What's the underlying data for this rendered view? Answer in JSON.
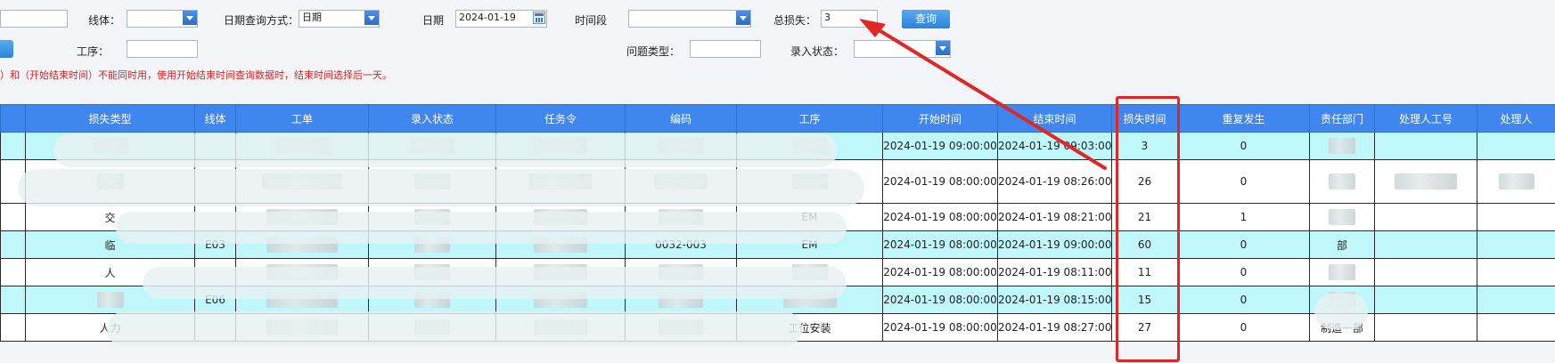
{
  "filters": {
    "line_label": "线体：",
    "date_query_mode_label": "日期查询方式：",
    "date_query_mode_value": "日期",
    "date_label": "日期",
    "date_value": "2024-01-19",
    "time_period_label": "时间段",
    "total_loss_label": "总损失：",
    "total_loss_value": "3",
    "query_button": "查询",
    "process_label": "工序：",
    "issue_type_label": "问题类型：",
    "entry_status_label": "录入状态：",
    "warning_text": "）和（开始结束时间）不能同时用，使用开始结束时间查询数据时，结束时间选择后一天。"
  },
  "table": {
    "headers": [
      "损失类型",
      "线体",
      "工单",
      "录入状态",
      "任务令",
      "编码",
      "工序",
      "开始时间",
      "结束时间",
      "损失时间",
      "重复发生",
      "责任部门",
      "处理人工号",
      "处理人"
    ],
    "rows": [
      {
        "loss_type": "",
        "line": "",
        "order": "",
        "status": "",
        "task": "",
        "code": "",
        "process": "",
        "start": "2024-01-19 09:00:00",
        "end": "2024-01-19 09:03:00",
        "loss_time": "3",
        "repeat": "0",
        "dept": ""
      },
      {
        "loss_type": "",
        "line": "",
        "order": "",
        "status": "",
        "task": "",
        "code": "",
        "process": "",
        "start": "2024-01-19 08:00:00",
        "end": "2024-01-19 08:26:00",
        "loss_time": "26",
        "repeat": "0",
        "dept": ""
      },
      {
        "loss_type": "交",
        "line": "",
        "order": "",
        "status": "",
        "task": "",
        "code": "",
        "process": "EM",
        "start": "2024-01-19 08:00:00",
        "end": "2024-01-19 08:21:00",
        "loss_time": "21",
        "repeat": "1",
        "dept": ""
      },
      {
        "loss_type": "临",
        "line": "E03",
        "order": "",
        "status": "",
        "task": "",
        "code": "0032-003",
        "process": "EM",
        "start": "2024-01-19 08:00:00",
        "end": "2024-01-19 09:00:00",
        "loss_time": "60",
        "repeat": "0",
        "dept": "部"
      },
      {
        "loss_type": "人",
        "line": "",
        "order": "",
        "status": "",
        "task": "",
        "code": "",
        "process": "",
        "start": "2024-01-19 08:00:00",
        "end": "2024-01-19 08:11:00",
        "loss_time": "11",
        "repeat": "0",
        "dept": ""
      },
      {
        "loss_type": "",
        "line": "E06",
        "order": "",
        "status": "",
        "task": "",
        "code": "",
        "process": "",
        "start": "2024-01-19 08:00:00",
        "end": "2024-01-19 08:15:00",
        "loss_time": "15",
        "repeat": "0",
        "dept": ""
      },
      {
        "loss_type": "人力",
        "line": "",
        "order": "",
        "status": "",
        "task": "",
        "code": "",
        "process": "工位安装",
        "start": "2024-01-19 08:00:00",
        "end": "2024-01-19 08:27:00",
        "loss_time": "27",
        "repeat": "0",
        "dept": "制造一部"
      }
    ]
  },
  "colors": {
    "header_blue": "#3f86ee",
    "row_cyan": "#bff7fb",
    "highlight_red": "#e12626"
  }
}
